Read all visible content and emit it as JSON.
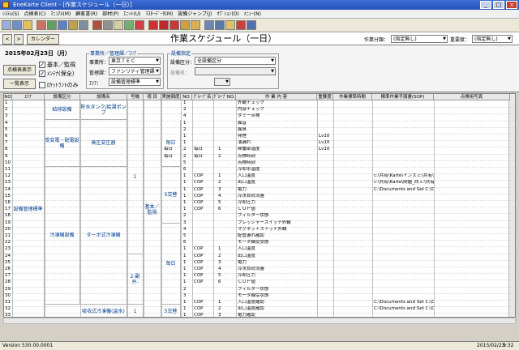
{
  "window": {
    "title": "EneKarte Client - [作業スケジュール（一日）]"
  },
  "menu": [
    "ｼｽﾃﾑ(S)",
    "点検表(C)",
    "ﾏﾆｭｱﾙ(M)",
    "顧客書(R)",
    "部材(P)",
    "ｴﾆｯﾄ(U)",
    "ﾏｽﾀｰﾃﾞｰﾀ(M)",
    "設備ジャンプ(J)",
    "ｵﾌﾟｼｮﾝ(O)",
    "ﾒﾆｭｰ(N)"
  ],
  "header": {
    "back_label": "<",
    "forward_label": ">",
    "calendar_label": "カレンダー",
    "page_title": "作業スケジュール（一日）",
    "filter1_label": "作業分類：",
    "filter1_value": "(指定無し)",
    "filter2_label": "重要度：",
    "filter2_value": "(指定無し)"
  },
  "panel": {
    "date": "2015年02月23日（月）",
    "btn_inspection": "点検表表示",
    "btn_list": "一覧表示",
    "chk_basic": "基本／監視",
    "chk_maint": "ﾒﾝﾃﾅ(保全)",
    "chk_route": "ﾛｹｯﾄﾗﾝﾄのみ",
    "office_group": "事業所／管理課／ｴﾘｱ",
    "office_label": "事業所：",
    "office_value": "東京ＴＥＣ",
    "section_label": "管理課：",
    "section_value": "ファシリティ管理課",
    "area_label": "ｴﾘｱ：",
    "area_value": "設備管理標準",
    "equip_group": "設備指定",
    "equip_class_label": "設備区分：",
    "equip_class_value": "全設備区分",
    "equip_name_label": "設備名："
  },
  "grid": {
    "columns": [
      "NO",
      "ｴﾘｱ",
      "設備区分",
      "設備名",
      "号機",
      "項 目",
      "実施頻度",
      "NO",
      "ｸﾞﾙｰﾌﾟ名",
      "ｸﾞﾙｰﾌﾟNO.",
      "作 業 内 容",
      "重要度",
      "作業標準時間",
      "標準作業手順書(SOP)",
      "点検用写真"
    ],
    "rows": [
      {
        "no": "1",
        "freq": "",
        "gno": "1",
        "gname": "",
        "grp": "",
        "task": "外観チェック",
        "imp": "",
        "sop": ""
      },
      {
        "no": "2",
        "freq": "",
        "gno": "2",
        "gname": "",
        "grp": "",
        "task": "内部チェック",
        "imp": "",
        "sop": ""
      },
      {
        "no": "3",
        "freq": "",
        "gno": "4",
        "gname": "",
        "grp": "",
        "task": "ダミー点検",
        "imp": "",
        "sop": ""
      },
      {
        "no": "4",
        "freq": "",
        "gno": "1",
        "gname": "",
        "grp": "",
        "task": "異音",
        "imp": "",
        "sop": ""
      },
      {
        "no": "5",
        "freq": "",
        "gno": "2",
        "gname": "",
        "grp": "",
        "task": "異臭",
        "imp": "",
        "sop": ""
      },
      {
        "no": "6",
        "freq": "",
        "gno": "1",
        "gname": "",
        "grp": "",
        "task": "発煙",
        "imp": "Lv10",
        "sop": ""
      },
      {
        "no": "7",
        "freq": "",
        "gno": "1",
        "gname": "",
        "grp": "",
        "task": "油漏れ",
        "imp": "Lv10",
        "sop": ""
      },
      {
        "no": "8",
        "freq": "毎日",
        "gno": "2",
        "gname": "毎日",
        "grp": "1",
        "task": "稼働部温度",
        "imp": "Lv10",
        "sop": ""
      },
      {
        "no": "9",
        "freq": "毎日",
        "gno": "2",
        "gname": "毎日",
        "grp": "2",
        "task": "点検時刻",
        "imp": "",
        "sop": ""
      },
      {
        "no": "10",
        "freq": "",
        "gno": "5",
        "gname": "",
        "grp": "",
        "task": "点検時刻",
        "imp": "",
        "sop": ""
      },
      {
        "no": "11",
        "freq": "",
        "gno": "6",
        "gname": "",
        "grp": "",
        "task": "冷却水温度",
        "imp": "",
        "sop": ""
      },
      {
        "no": "12",
        "freq": "",
        "gno": "1",
        "gname": "COP",
        "grp": "1",
        "task": "入口温度",
        "imp": "",
        "sop": "c:\\共有\\Karte\\インス  c:\\共有\\Snape"
      },
      {
        "no": "13",
        "freq": "",
        "gno": "1",
        "gname": "COP",
        "grp": "2",
        "task": "出口温度",
        "imp": "",
        "sop": "c:\\共有\\Karte\\問題_西  c:\\共有\\Wint"
      },
      {
        "no": "14",
        "freq": "",
        "gno": "1",
        "gname": "COP",
        "grp": "3",
        "task": "電力",
        "imp": "",
        "sop": "C:\\Documents and Set C:\\Documents"
      },
      {
        "no": "15",
        "freq": "",
        "gno": "1",
        "gname": "COP",
        "grp": "4",
        "task": "冷水負荷流量",
        "imp": "",
        "sop": ""
      },
      {
        "no": "16",
        "freq": "",
        "gno": "1",
        "gname": "COP",
        "grp": "5",
        "task": "冷却圧力",
        "imp": "",
        "sop": ""
      },
      {
        "no": "17",
        "freq": "",
        "gno": "1",
        "gname": "COP",
        "grp": "6",
        "task": "ＣＯＰ値",
        "imp": "",
        "sop": ""
      },
      {
        "no": "18",
        "freq": "",
        "gno": "2",
        "gname": "",
        "grp": "",
        "task": "フィルター状態",
        "imp": "",
        "sop": ""
      },
      {
        "no": "19",
        "freq": "",
        "gno": "3",
        "gname": "",
        "grp": "",
        "task": "プレッシャースイッチ外観",
        "imp": "",
        "sop": ""
      },
      {
        "no": "20",
        "freq": "",
        "gno": "4",
        "gname": "",
        "grp": "",
        "task": "マグネットスイッチ外観",
        "imp": "",
        "sop": ""
      },
      {
        "no": "21",
        "freq": "",
        "gno": "5",
        "gname": "",
        "grp": "",
        "task": "配管漏れ確認",
        "imp": "",
        "sop": ""
      },
      {
        "no": "22",
        "freq": "",
        "gno": "6",
        "gname": "",
        "grp": "",
        "task": "モータ軸受状態",
        "imp": "",
        "sop": ""
      },
      {
        "no": "23",
        "freq": "",
        "gno": "1",
        "gname": "COP",
        "grp": "1",
        "task": "入口温度",
        "imp": "",
        "sop": ""
      },
      {
        "no": "24",
        "freq": "",
        "gno": "1",
        "gname": "COP",
        "grp": "2",
        "task": "出口温度",
        "imp": "",
        "sop": ""
      },
      {
        "no": "25",
        "freq": "",
        "gno": "1",
        "gname": "COP",
        "grp": "3",
        "task": "電力",
        "imp": "",
        "sop": ""
      },
      {
        "no": "26",
        "freq": "",
        "gno": "1",
        "gname": "COP",
        "grp": "4",
        "task": "冷水負荷流量",
        "imp": "",
        "sop": ""
      },
      {
        "no": "27",
        "freq": "",
        "gno": "1",
        "gname": "COP",
        "grp": "5",
        "task": "冷却圧力",
        "imp": "",
        "sop": ""
      },
      {
        "no": "28",
        "freq": "",
        "gno": "1",
        "gname": "COP",
        "grp": "6",
        "task": "ＣＯＰ値",
        "imp": "",
        "sop": ""
      },
      {
        "no": "29",
        "freq": "",
        "gno": "2",
        "gname": "",
        "grp": "",
        "task": "フィルター状態",
        "imp": "",
        "sop": ""
      },
      {
        "no": "30",
        "freq": "",
        "gno": "3",
        "gname": "",
        "grp": "",
        "task": "モータ軸受状態",
        "imp": "",
        "sop": ""
      },
      {
        "no": "31",
        "freq": "",
        "gno": "1",
        "gname": "COP",
        "grp": "1",
        "task": "入口温度確認",
        "imp": "",
        "sop": "C:\\Documents and Set C:\\Documents"
      },
      {
        "no": "32",
        "freq": "",
        "gno": "1",
        "gname": "COP",
        "grp": "2",
        "task": "出口温度確認",
        "imp": "",
        "sop": "C:\\Documents and Set C:\\Documents"
      },
      {
        "no": "33",
        "freq": "",
        "gno": "1",
        "gname": "COP",
        "grp": "3",
        "task": "電力確認",
        "imp": "",
        "sop": ""
      }
    ],
    "merged": {
      "area": "設備管理標準",
      "cat1": "給排設備",
      "cat2": "受変電・配電設備",
      "cat3": "冷凍機設備",
      "eq1": "貯水タンク/給湯ポンプ",
      "eq2": "高圧変圧器",
      "eq3": "ターボ式冷凍機",
      "eq4": "吸収式冷凍機(温水)",
      "unit1": "1",
      "unit2": "2-副弁-",
      "unit3": "1",
      "item": "基本／監視",
      "freq_daily": "毎日",
      "freq_daily2": "毎日",
      "freq_5": "5交替",
      "freq_5b": "5交替"
    }
  },
  "status": {
    "version": "Version 530.00.0001",
    "date": "2015/02/23",
    "time": "9:32"
  }
}
